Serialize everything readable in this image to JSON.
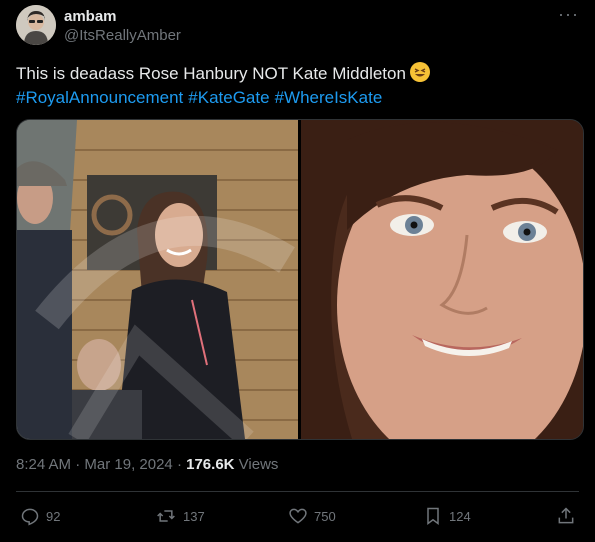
{
  "author": {
    "display_name": "ambam",
    "handle": "@ItsReallyAmber",
    "avatar_icon": "user-avatar"
  },
  "tweet": {
    "text": "This is deadass Rose Hanbury NOT Kate Middleton",
    "emoji_icon": "grinning-squinting-face-icon",
    "hashtags": [
      "#RoyalAnnouncement",
      "#KateGate",
      "#WhereIsKate"
    ]
  },
  "media": {
    "left_image": "photo-woman-smiling-outdoors-wooden-building",
    "right_image": "photo-woman-closeup-smiling"
  },
  "meta": {
    "time": "8:24 AM",
    "separator": "·",
    "date": "Mar 19, 2024",
    "views_count": "176.6K",
    "views_label": "Views"
  },
  "actions": {
    "replies": "92",
    "reposts": "137",
    "likes": "750",
    "bookmarks": "124"
  },
  "colors": {
    "background": "#000000",
    "text": "#e7e9ea",
    "secondary": "#71767b",
    "link": "#1d9bf0",
    "border": "#2f3336"
  }
}
